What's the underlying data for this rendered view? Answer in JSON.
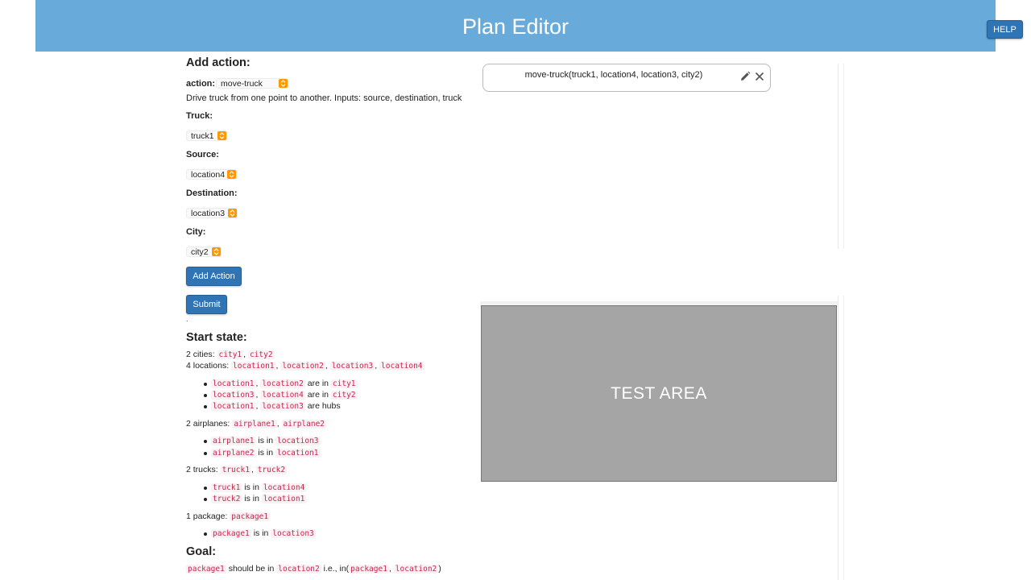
{
  "header": {
    "title": "Plan Editor",
    "help_label": "HELP"
  },
  "add_action": {
    "heading": "Add action:",
    "action_label": "action:",
    "action_value": "move-truck",
    "description": "Drive truck from one point to another. Inputs: source, destination, truck",
    "truck_label": "Truck:",
    "truck_value": "truck1",
    "source_label": "Source:",
    "source_value": "location4",
    "destination_label": "Destination:",
    "destination_value": "location3",
    "city_label": "City:",
    "city_value": "city2",
    "add_button": "Add Action",
    "submit_button": "Submit",
    "dot": "."
  },
  "start_state": {
    "heading": "Start state:",
    "cities_prefix": "2 cities:",
    "cities": [
      "city1",
      "city2"
    ],
    "locations_prefix": "4 locations:",
    "locations": [
      "location1",
      "location2",
      "location3",
      "location4"
    ],
    "loc_bullets": [
      {
        "a": "location1",
        "b": "location2",
        "mid": "are in",
        "c": "city1"
      },
      {
        "a": "location3",
        "b": "location4",
        "mid": "are in",
        "c": "city2"
      },
      {
        "a": "location1",
        "b": "location3",
        "mid": "are hubs"
      }
    ],
    "airplanes_prefix": "2 airplanes:",
    "airplanes": [
      "airplane1",
      "airplane2"
    ],
    "airplane_bullets": [
      {
        "a": "airplane1",
        "mid": "is in",
        "c": "location3"
      },
      {
        "a": "airplane2",
        "mid": "is in",
        "c": "location1"
      }
    ],
    "trucks_prefix": "2 trucks:",
    "trucks": [
      "truck1",
      "truck2"
    ],
    "truck_bullets": [
      {
        "a": "truck1",
        "mid": "is in",
        "c": "location4"
      },
      {
        "a": "truck2",
        "mid": "is in",
        "c": "location1"
      }
    ],
    "packages_prefix": "1 package:",
    "packages": [
      "package1"
    ],
    "package_bullets": [
      {
        "a": "package1",
        "mid": "is in",
        "c": "location3"
      }
    ]
  },
  "goal": {
    "heading": "Goal:",
    "item": "package1",
    "mid": "should be in",
    "target": "location2",
    "ie": "i.e., in(",
    "p1": "package1",
    "p2": "location2",
    "close": ")"
  },
  "plan": {
    "action_text": "move-truck(truck1, location4, location3, city2)"
  },
  "test_area": {
    "label": "TEST AREA"
  },
  "colors": {
    "header_bg": "#68abdb",
    "button_bg": "#2f74b5",
    "caret": "#ff9800",
    "code_fg": "#c7254e"
  },
  "icons": [
    "chevron-updown-icon",
    "pencil-icon",
    "close-icon"
  ]
}
